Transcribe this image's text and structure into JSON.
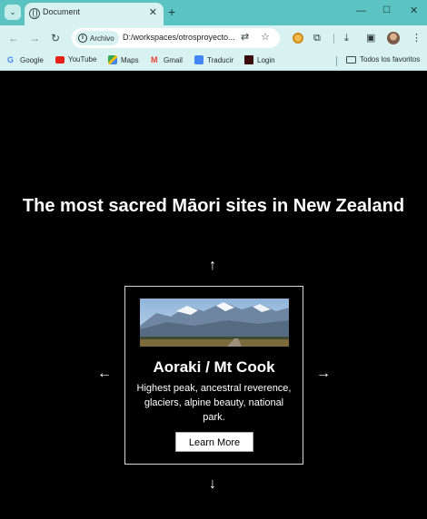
{
  "browser": {
    "tab": {
      "title": "Document"
    },
    "omnibox": {
      "origin_chip": "Archivo",
      "url": "D:/workspaces/otrosproyecto..."
    },
    "bookmarks": [
      {
        "label": "Google"
      },
      {
        "label": "YouTube"
      },
      {
        "label": "Maps"
      },
      {
        "label": "Gmail"
      },
      {
        "label": "Traducir"
      },
      {
        "label": "Login"
      }
    ],
    "all_bookmarks": "Todos los favoritos"
  },
  "page": {
    "heading": "The most sacred Māori sites in New Zealand",
    "arrows": {
      "up": "↑",
      "down": "↓",
      "left": "←",
      "right": "→"
    },
    "card": {
      "title": "Aoraki / Mt Cook",
      "description": "Highest peak, ancestral reverence, glaciers, alpine beauty, national park.",
      "button": "Learn More"
    }
  }
}
